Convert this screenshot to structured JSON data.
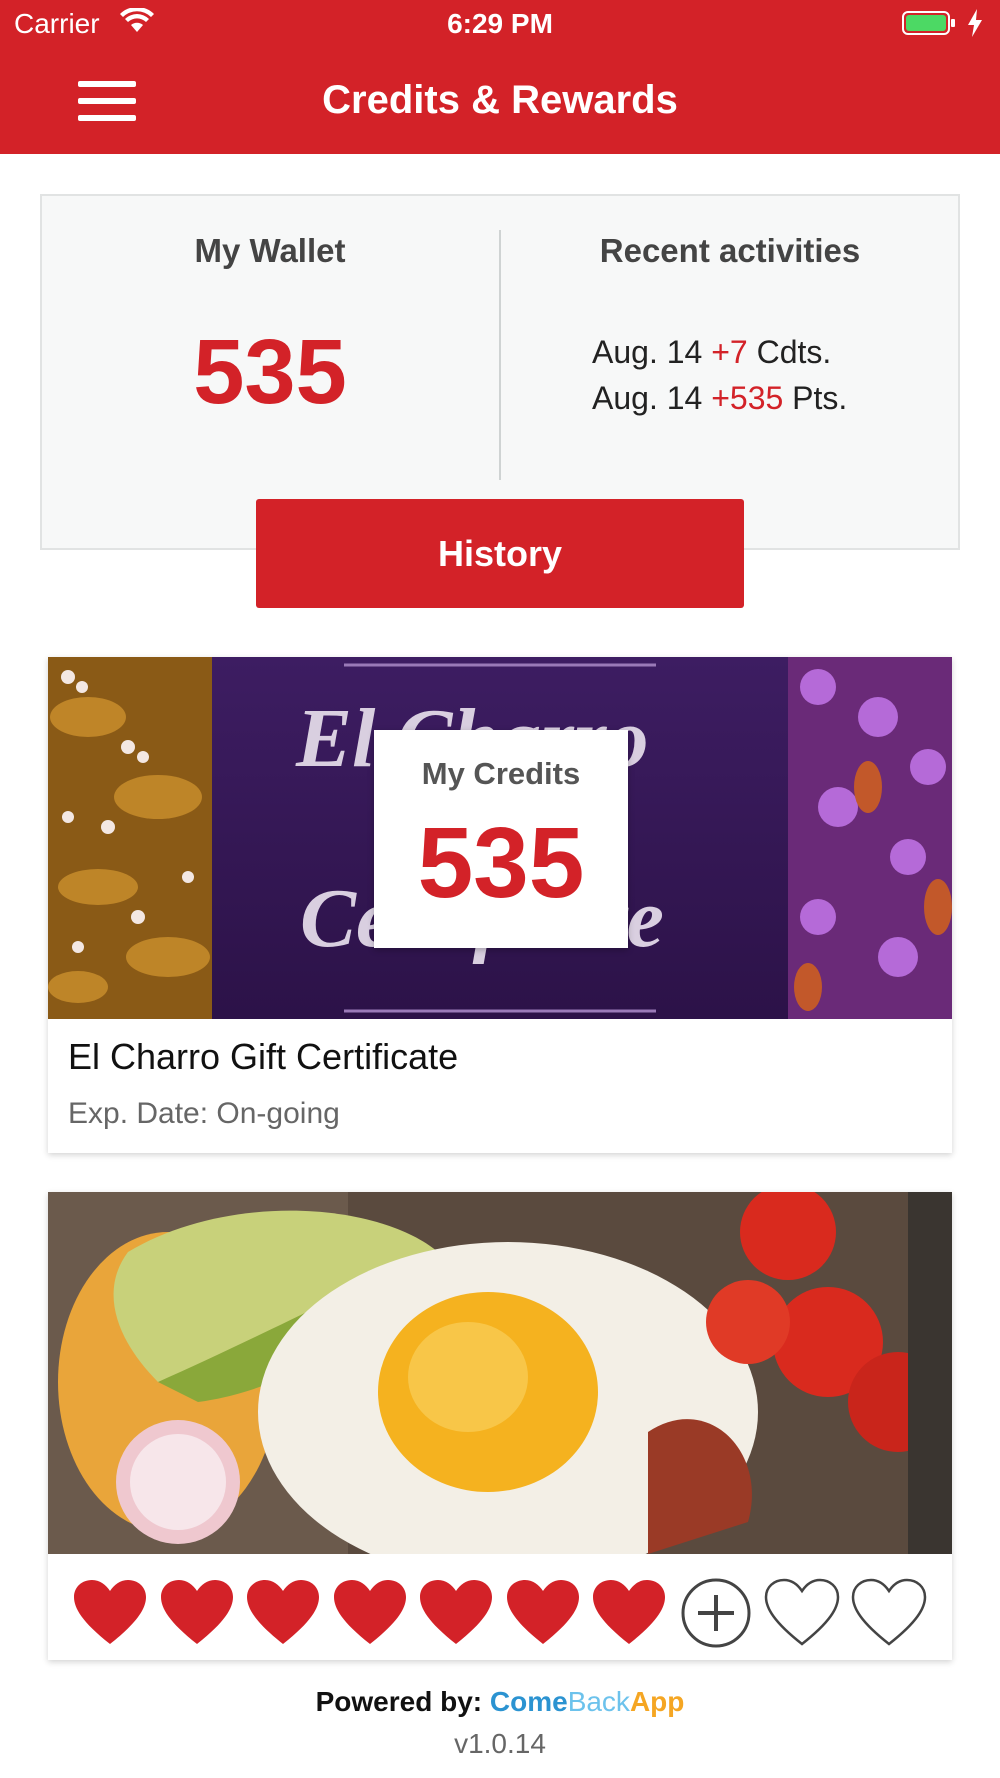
{
  "status_bar": {
    "carrier": "Carrier",
    "time": "6:29 PM"
  },
  "header": {
    "title": "Credits & Rewards"
  },
  "wallet": {
    "title": "My Wallet",
    "value": "535",
    "recent_title": "Recent activities",
    "activities": [
      {
        "date": "Aug. 14",
        "amount": "+7",
        "unit": "Cdts."
      },
      {
        "date": "Aug. 14",
        "amount": "+535",
        "unit": "Pts."
      }
    ],
    "history_label": "History"
  },
  "certificate": {
    "banner_text_line1": "El Charro",
    "banner_text_line2": "Certificate",
    "credits_label": "My Credits",
    "credits_value": "535",
    "name": "El Charro Gift Certificate",
    "expiry": "Exp. Date: On-going"
  },
  "rewards": {
    "filled_hearts": 7,
    "total_slots": 10
  },
  "footer": {
    "powered_by": "Powered by:",
    "brand_part1": "Come",
    "brand_part2": "Back",
    "brand_part3": "App",
    "version": "v1.0.14"
  },
  "colors": {
    "brand_red": "#d32228",
    "banner_purple": "#3a1a5c"
  }
}
